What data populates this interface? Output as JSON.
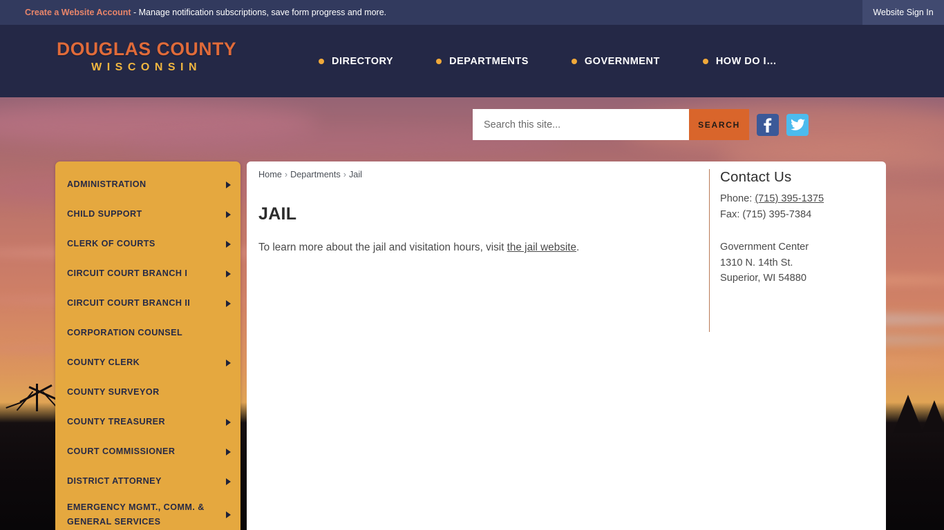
{
  "utility_bar": {
    "create_account_label": "Create a Website Account",
    "tagline": " - Manage notification subscriptions, save form progress and more.",
    "signin_label": "Website Sign In"
  },
  "header": {
    "logo_line1": "DOUGLAS COUNTY",
    "logo_line2": "WISCONSIN",
    "nav": [
      {
        "label": "DIRECTORY"
      },
      {
        "label": "DEPARTMENTS"
      },
      {
        "label": "GOVERNMENT"
      },
      {
        "label": "HOW DO I…"
      }
    ]
  },
  "search": {
    "placeholder": "Search this site...",
    "value": "",
    "button_label": "SEARCH",
    "facebook_icon": "facebook-icon",
    "twitter_icon": "twitter-icon"
  },
  "sidebar": {
    "items": [
      {
        "label": "ADMINISTRATION",
        "arrow": true
      },
      {
        "label": "CHILD SUPPORT",
        "arrow": true
      },
      {
        "label": "CLERK OF COURTS",
        "arrow": true
      },
      {
        "label": "CIRCUIT COURT BRANCH I",
        "arrow": true
      },
      {
        "label": "CIRCUIT COURT BRANCH II",
        "arrow": true
      },
      {
        "label": "CORPORATION COUNSEL",
        "arrow": false
      },
      {
        "label": "COUNTY CLERK",
        "arrow": true
      },
      {
        "label": "COUNTY SURVEYOR",
        "arrow": false
      },
      {
        "label": "COUNTY TREASURER",
        "arrow": true
      },
      {
        "label": "COURT COMMISSIONER",
        "arrow": true
      },
      {
        "label": "DISTRICT ATTORNEY",
        "arrow": true
      },
      {
        "label": "EMERGENCY MGMT., COMM. & GENERAL SERVICES",
        "arrow": true
      }
    ]
  },
  "content": {
    "breadcrumb": [
      {
        "label": "Home"
      },
      {
        "label": "Departments"
      },
      {
        "label": "Jail"
      }
    ],
    "breadcrumb_separator": "›",
    "page_title": "JAIL",
    "paragraph_before": "To learn more about the jail and visitation hours, visit ",
    "paragraph_link": "the jail website",
    "paragraph_after": "."
  },
  "contact": {
    "title": "Contact Us",
    "phone_label": "Phone: ",
    "phone_number": "(715) 395-1375",
    "fax_line": "Fax: (715) 395-7384",
    "address_line1": "Government Center",
    "address_line2": "1310 N. 14th St.",
    "address_line3": "Superior, WI 54880"
  },
  "colors": {
    "utility_bar": "#323a5e",
    "header": "#242846",
    "accent_orange": "#d9652b",
    "logo_orange": "#e06b3a",
    "logo_gold": "#f0b640",
    "sidebar_gold": "#e5a83f",
    "nav_dot": "#f0a93a",
    "facebook_blue": "#3b5998",
    "twitter_blue": "#4cbbee",
    "contact_rule": "#b97a57"
  }
}
